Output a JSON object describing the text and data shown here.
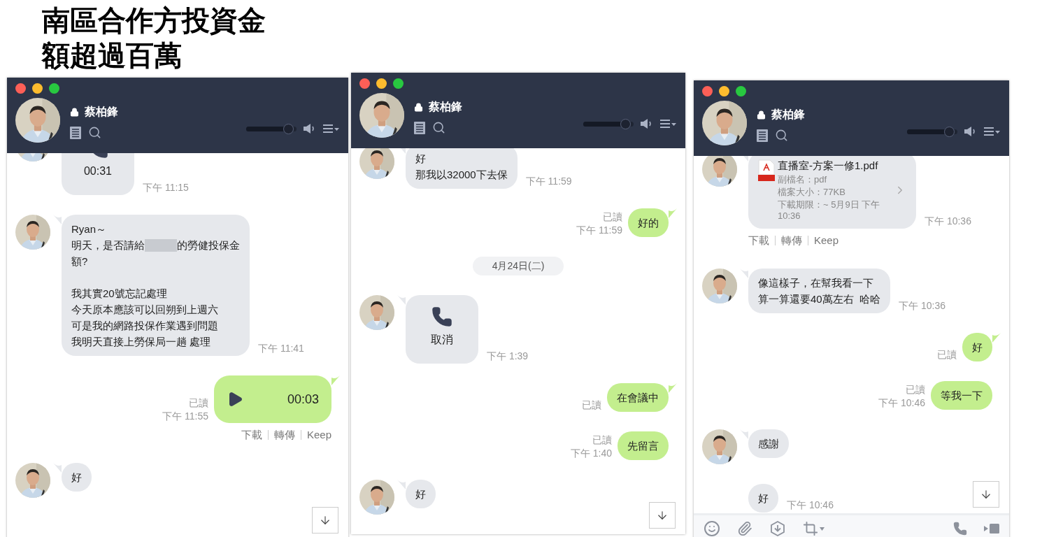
{
  "slide": {
    "title_lines": [
      "南區合作方投資金",
      "額超過百萬"
    ]
  },
  "windows": [
    {
      "contact": {
        "name": "蔡柏鋒",
        "locked": true
      },
      "volume": {
        "level": 0.85
      },
      "messages": [
        {
          "kind": "incoming_call",
          "avatar": true,
          "tail": false,
          "text": "00:31",
          "time": "下午 11:15"
        },
        {
          "kind": "incoming_text",
          "avatar": true,
          "tail": true,
          "paragraphs": [
            [
              "Ryan～",
              [
                "明天，是否請給",
                "的勞健投保金"
              ],
              "額?"
            ],
            [
              "我其實20號忘記處理",
              "今天原本應該可以回朔到上週六",
              "可是我的網路投保作業遇到問題",
              "我明天直接上勞保局一趟 處理"
            ]
          ],
          "time": "下午 11:41"
        },
        {
          "kind": "outgoing_voice",
          "tail": true,
          "duration": "00:03",
          "read": "已讀",
          "time": "下午 11:55",
          "actions": [
            "下載",
            "轉傳",
            "Keep"
          ]
        },
        {
          "kind": "incoming_text",
          "avatar": true,
          "tail": true,
          "paragraphs": [
            [
              "好"
            ]
          ]
        }
      ],
      "scroll_down": true
    },
    {
      "contact": {
        "name": "蔡柏鋒",
        "locked": true
      },
      "volume": {
        "level": 0.85
      },
      "messages": [
        {
          "kind": "incoming_text",
          "avatar": true,
          "tail": true,
          "paragraphs": [
            [
              "好",
              "那我以32000下去保"
            ]
          ],
          "time": "下午 11:59"
        },
        {
          "kind": "outgoing_text",
          "tail": true,
          "paragraphs": [
            [
              "好的"
            ]
          ],
          "read": "已讀",
          "time": "下午 11:59"
        },
        {
          "kind": "date",
          "text": "4月24日(二)"
        },
        {
          "kind": "incoming_call",
          "avatar": true,
          "tail": true,
          "text": "取消",
          "time": "下午 1:39"
        },
        {
          "kind": "outgoing_text",
          "tail": true,
          "paragraphs": [
            [
              "在會議中"
            ]
          ],
          "read": "已讀"
        },
        {
          "kind": "outgoing_text",
          "tail": false,
          "paragraphs": [
            [
              "先留言"
            ]
          ],
          "read": "已讀",
          "time": "下午 1:40"
        },
        {
          "kind": "incoming_text",
          "avatar": true,
          "tail": true,
          "paragraphs": [
            [
              "好"
            ]
          ]
        }
      ],
      "scroll_down": true
    },
    {
      "contact": {
        "name": "蔡柏鋒",
        "locked": true
      },
      "volume": {
        "level": 0.85
      },
      "messages": [
        {
          "kind": "incoming_file",
          "avatar": true,
          "tail": true,
          "file_name": "直播室-方案一修1.pdf",
          "details": [
            "副檔名：pdf",
            "檔案大小：77KB",
            "下載期限：~ 5月9日 下午 10:36"
          ],
          "time": "下午 10:36",
          "actions": [
            "下載",
            "轉傳",
            "Keep"
          ]
        },
        {
          "kind": "incoming_text",
          "avatar": true,
          "tail": true,
          "paragraphs": [
            [
              "像這樣子，在幫我看一下",
              "算一算還要40萬左右  哈哈"
            ]
          ],
          "time": "下午 10:36"
        },
        {
          "kind": "outgoing_text",
          "tail": true,
          "paragraphs": [
            [
              "好"
            ]
          ],
          "read": "已讀"
        },
        {
          "kind": "outgoing_text",
          "tail": false,
          "paragraphs": [
            [
              "等我一下"
            ]
          ],
          "read": "已讀",
          "time": "下午 10:46"
        },
        {
          "kind": "incoming_text",
          "avatar": true,
          "tail": true,
          "paragraphs": [
            [
              "感謝"
            ]
          ]
        },
        {
          "kind": "incoming_text",
          "avatar": false,
          "tail": false,
          "paragraphs": [
            [
              "好"
            ]
          ],
          "time": "下午 10:46"
        }
      ],
      "scroll_down": true,
      "input_toolbar": [
        {
          "kind": "emoji"
        },
        {
          "kind": "attach"
        },
        {
          "kind": "keep"
        },
        {
          "kind": "capture"
        },
        {
          "kind": "call"
        },
        {
          "kind": "video"
        }
      ]
    }
  ]
}
